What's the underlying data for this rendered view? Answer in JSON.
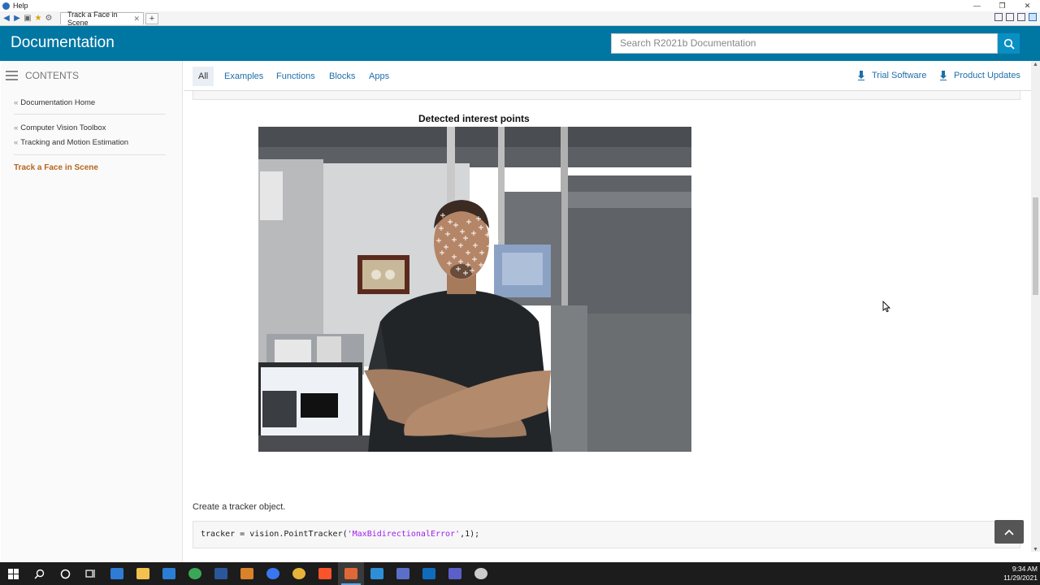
{
  "window": {
    "title": "Help",
    "controls": [
      "—",
      "❐",
      "✕"
    ]
  },
  "browser": {
    "tab_title": "Track a Face in Scene",
    "tab_close": "✕",
    "new_tab": "+"
  },
  "header": {
    "title": "Documentation",
    "search_placeholder": "Search R2021b Documentation"
  },
  "sidebar": {
    "contents_label": "CONTENTS",
    "quote_mark": "«",
    "links": [
      {
        "label": "Documentation Home"
      },
      {
        "label": "Computer Vision Toolbox"
      },
      {
        "label": "Tracking and Motion Estimation"
      }
    ],
    "active_page": "Track a Face in Scene"
  },
  "nav": {
    "tabs": [
      "All",
      "Examples",
      "Functions",
      "Blocks",
      "Apps"
    ],
    "active_tab": "All",
    "trial_software": "Trial Software",
    "product_updates": "Product Updates"
  },
  "content": {
    "figure_title": "Detected interest points",
    "paragraph": "Create a tracker object.",
    "code": {
      "prefix": "tracker = vision.PointTracker(",
      "string_arg": "'MaxBidirectionalError'",
      "suffix": ",1);"
    }
  },
  "taskbar": {
    "time": "9:34 AM",
    "date": "11/29/2021",
    "apps": [
      {
        "name": "windows-start-icon",
        "color": "#ffffff"
      },
      {
        "name": "search-icon",
        "color": "#ffffff"
      },
      {
        "name": "cortana-icon",
        "color": "#ffffff"
      },
      {
        "name": "task-view-icon",
        "color": "#ffffff"
      },
      {
        "name": "store-icon",
        "color": "#2f7bd6"
      },
      {
        "name": "file-explorer-icon",
        "color": "#f2c14e"
      },
      {
        "name": "mail-icon",
        "color": "#2a7fd4"
      },
      {
        "name": "edge-icon",
        "color": "#3aa757"
      },
      {
        "name": "word-icon",
        "color": "#2b579a"
      },
      {
        "name": "paint-icon",
        "color": "#d9822b"
      },
      {
        "name": "signal-icon",
        "color": "#3a76f0"
      },
      {
        "name": "chrome-icon",
        "color": "#e7b43a"
      },
      {
        "name": "brave-icon",
        "color": "#fb542b"
      },
      {
        "name": "matlab-icon",
        "color": "#e16737"
      },
      {
        "name": "vscode-icon",
        "color": "#2f8fd6"
      },
      {
        "name": "app-icon",
        "color": "#5b6fc9"
      },
      {
        "name": "outlook-icon",
        "color": "#0f6cbd"
      },
      {
        "name": "teams-icon",
        "color": "#5b5fc7"
      },
      {
        "name": "obs-icon",
        "color": "#cccccc"
      }
    ]
  },
  "colors": {
    "header_blue": "#0077a3",
    "link_blue": "#1f6fa8",
    "active_orange": "#b7651f"
  }
}
